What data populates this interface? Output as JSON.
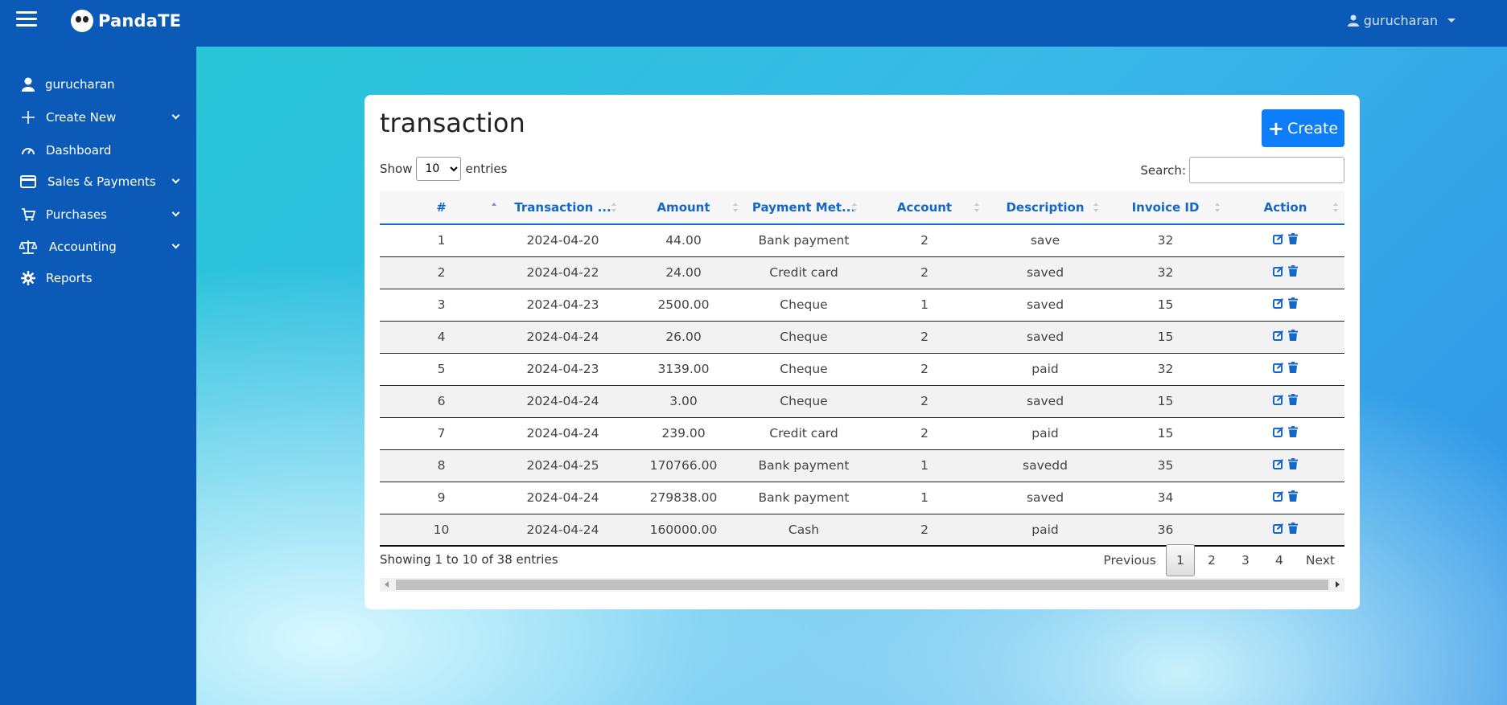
{
  "app": {
    "brand": "PandaTE",
    "user": "gurucharan"
  },
  "sidebar": {
    "items": [
      {
        "label": "gurucharan",
        "icon": "user-icon"
      },
      {
        "label": "Create New",
        "icon": "plus-icon"
      },
      {
        "label": "Dashboard",
        "icon": "gauge-icon"
      },
      {
        "label": "Sales & Payments",
        "icon": "credit-card-icon"
      },
      {
        "label": "Purchases",
        "icon": "cart-icon"
      },
      {
        "label": "Accounting",
        "icon": "scale-icon"
      },
      {
        "label": "Reports",
        "icon": "gear-icon"
      }
    ]
  },
  "page": {
    "title": "transaction",
    "create_label": "Create",
    "length": {
      "show": "Show",
      "value": "10",
      "entries": "entries"
    },
    "search_label": "Search:",
    "info": "Showing 1 to 10 of 38 entries",
    "pager": {
      "previous": "Previous",
      "next": "Next",
      "pages": [
        "1",
        "2",
        "3",
        "4"
      ],
      "current": "1"
    }
  },
  "table": {
    "headers": [
      "#",
      "Transaction ...",
      "Amount",
      "Payment Met...",
      "Account",
      "Description",
      "Invoice ID",
      "Action"
    ],
    "rows": [
      [
        "1",
        "2024-04-20",
        "44.00",
        "Bank payment",
        "2",
        "save",
        "32"
      ],
      [
        "2",
        "2024-04-22",
        "24.00",
        "Credit card",
        "2",
        "saved",
        "32"
      ],
      [
        "3",
        "2024-04-23",
        "2500.00",
        "Cheque",
        "1",
        "saved",
        "15"
      ],
      [
        "4",
        "2024-04-24",
        "26.00",
        "Cheque",
        "2",
        "saved",
        "15"
      ],
      [
        "5",
        "2024-04-23",
        "3139.00",
        "Cheque",
        "2",
        "paid",
        "32"
      ],
      [
        "6",
        "2024-04-24",
        "3.00",
        "Cheque",
        "2",
        "saved",
        "15"
      ],
      [
        "7",
        "2024-04-24",
        "239.00",
        "Credit card",
        "2",
        "paid",
        "15"
      ],
      [
        "8",
        "2024-04-25",
        "170766.00",
        "Bank payment",
        "1",
        "savedd",
        "35"
      ],
      [
        "9",
        "2024-04-24",
        "279838.00",
        "Bank payment",
        "1",
        "saved",
        "34"
      ],
      [
        "10",
        "2024-04-24",
        "160000.00",
        "Cash",
        "2",
        "paid",
        "36"
      ]
    ]
  },
  "colors": {
    "primary": "#0d7ef7",
    "sidebar": "#0b5ab7",
    "header_text": "#1567c8"
  }
}
